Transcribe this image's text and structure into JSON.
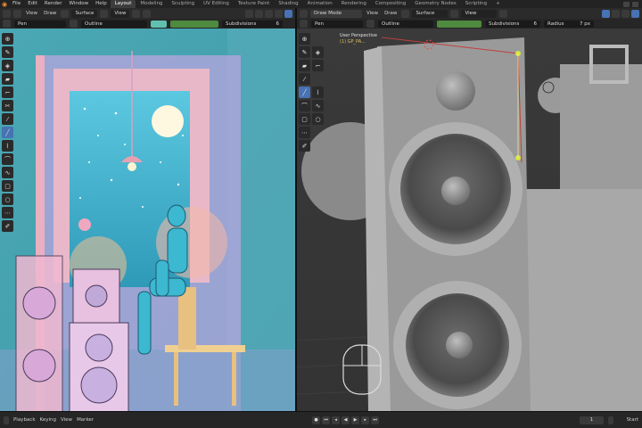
{
  "topbar": {
    "menus": [
      "File",
      "Edit",
      "Render",
      "Window",
      "Help"
    ],
    "workspaces": [
      "Layout",
      "Modeling",
      "Sculpting",
      "UV Editing",
      "Texture Paint",
      "Shading",
      "Animation",
      "Rendering",
      "Compositing",
      "Geometry Nodes",
      "Scripting"
    ],
    "active_workspace": "Layout"
  },
  "left_editor": {
    "header": {
      "view": "View",
      "draw": "Draw",
      "surface": "Surface",
      "view2": "View"
    },
    "tool_settings": {
      "brush": "Pen",
      "material": "Outline",
      "subdivisions_label": "Subdivisions",
      "subdivisions_value": "6"
    }
  },
  "right_editor": {
    "header": {
      "mode": "Draw Mode",
      "view": "View",
      "draw": "Draw",
      "surface": "Surface",
      "view2": "View"
    },
    "tool_settings": {
      "brush": "Pen",
      "material": "Outline",
      "subdivisions_label": "Subdivisions",
      "subdivisions_value": "6",
      "radius_label": "Radius",
      "radius_value": "7 px"
    },
    "viewport_info": {
      "perspective": "User Perspective",
      "object": "(1) GP_PA..."
    }
  },
  "timeline": {
    "playback": "Playback",
    "keying": "Keying",
    "view": "View",
    "marker": "Marker",
    "frame_value": "1",
    "start_label": "Start"
  },
  "colors": {
    "accent": "#4772b3",
    "green_bar": "#4e8a3f",
    "blender_orange": "#f09040",
    "yellow_point": "#d8e840"
  }
}
